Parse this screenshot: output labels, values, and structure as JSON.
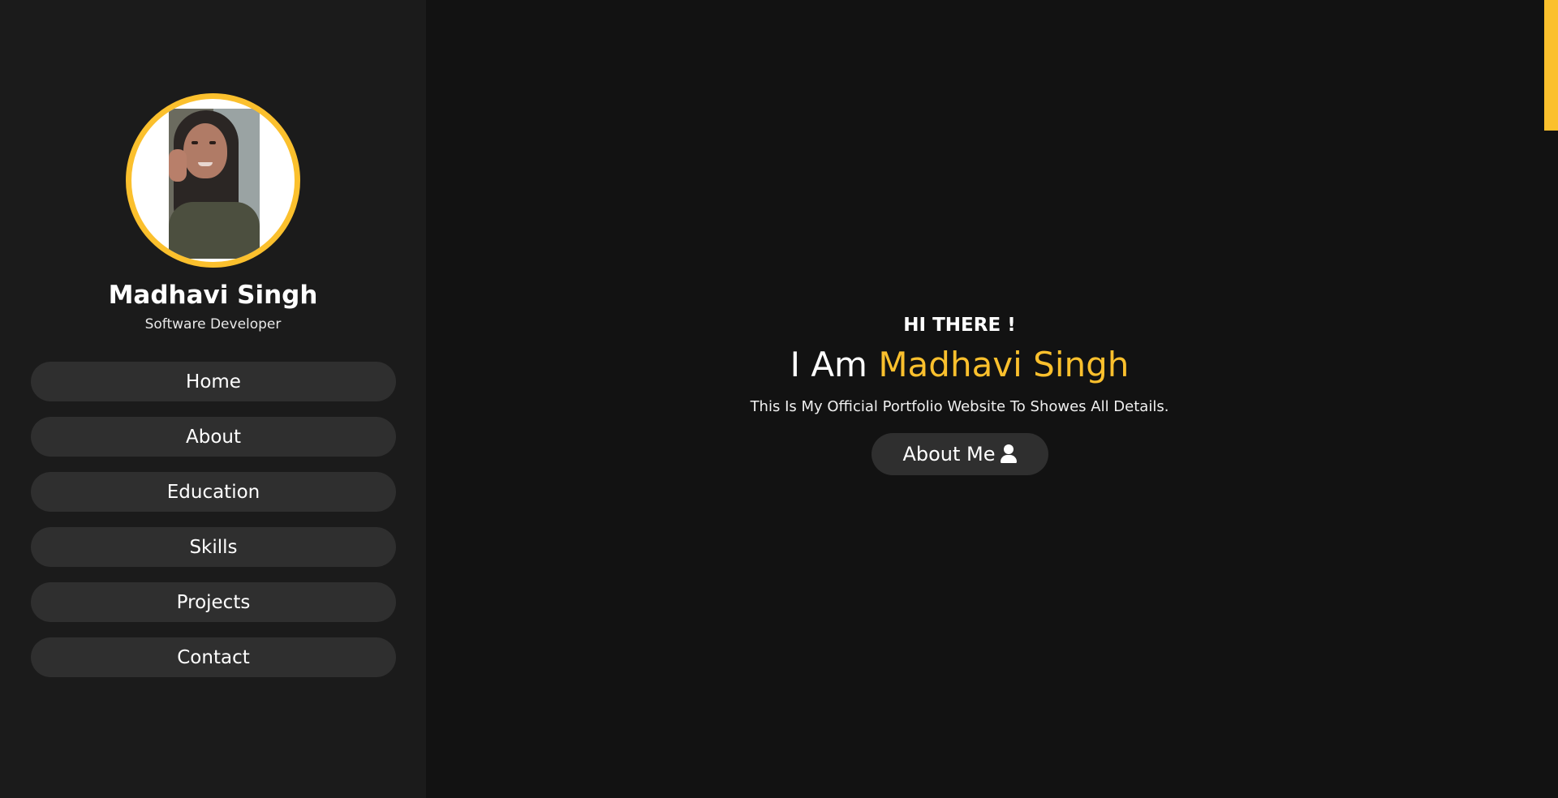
{
  "profile": {
    "name": "Madhavi Singh",
    "role": "Software Developer"
  },
  "nav": {
    "items": [
      {
        "label": "Home"
      },
      {
        "label": "About"
      },
      {
        "label": "Education"
      },
      {
        "label": "Skills"
      },
      {
        "label": "Projects"
      },
      {
        "label": "Contact"
      }
    ]
  },
  "hero": {
    "greeting": "HI THERE !",
    "headline_prefix": "I Am ",
    "headline_name": "Madhavi Singh",
    "tagline": "This Is My Official Portfolio Website To Showes All Details.",
    "button_label": "About Me",
    "button_icon": "user-icon"
  },
  "colors": {
    "accent": "#fbc02d",
    "sidebar_bg": "#1b1b1b",
    "main_bg": "#121212",
    "button_bg": "#2f2f2f"
  }
}
